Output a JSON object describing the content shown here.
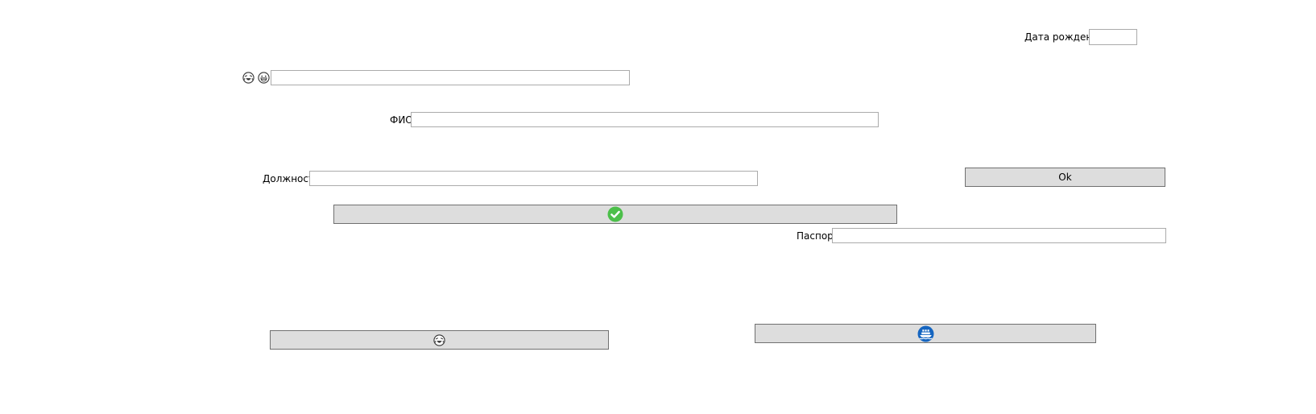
{
  "form": {
    "birth_date": {
      "label": "Дата рождения",
      "value": ""
    },
    "top_field": {
      "value": ""
    },
    "fio": {
      "label": "ФИО",
      "value": ""
    },
    "position": {
      "label": "Должность",
      "value": ""
    },
    "passport": {
      "label": "Паспорт",
      "value": ""
    }
  },
  "buttons": {
    "ok_label": "Ok"
  },
  "icons": {
    "top_left_1": "laughing-face-icon",
    "top_left_2": "grinning-face-icon",
    "confirm_button": "green-checkmark-icon",
    "lower_left_button": "laughing-face-icon",
    "lower_right_button": "blue-ship-icon"
  },
  "colors": {
    "button_bg": "#dddddd",
    "button_border": "#707070",
    "input_border": "#ababab",
    "check_green": "#4cbf4a",
    "ship_blue": "#1565c0"
  }
}
